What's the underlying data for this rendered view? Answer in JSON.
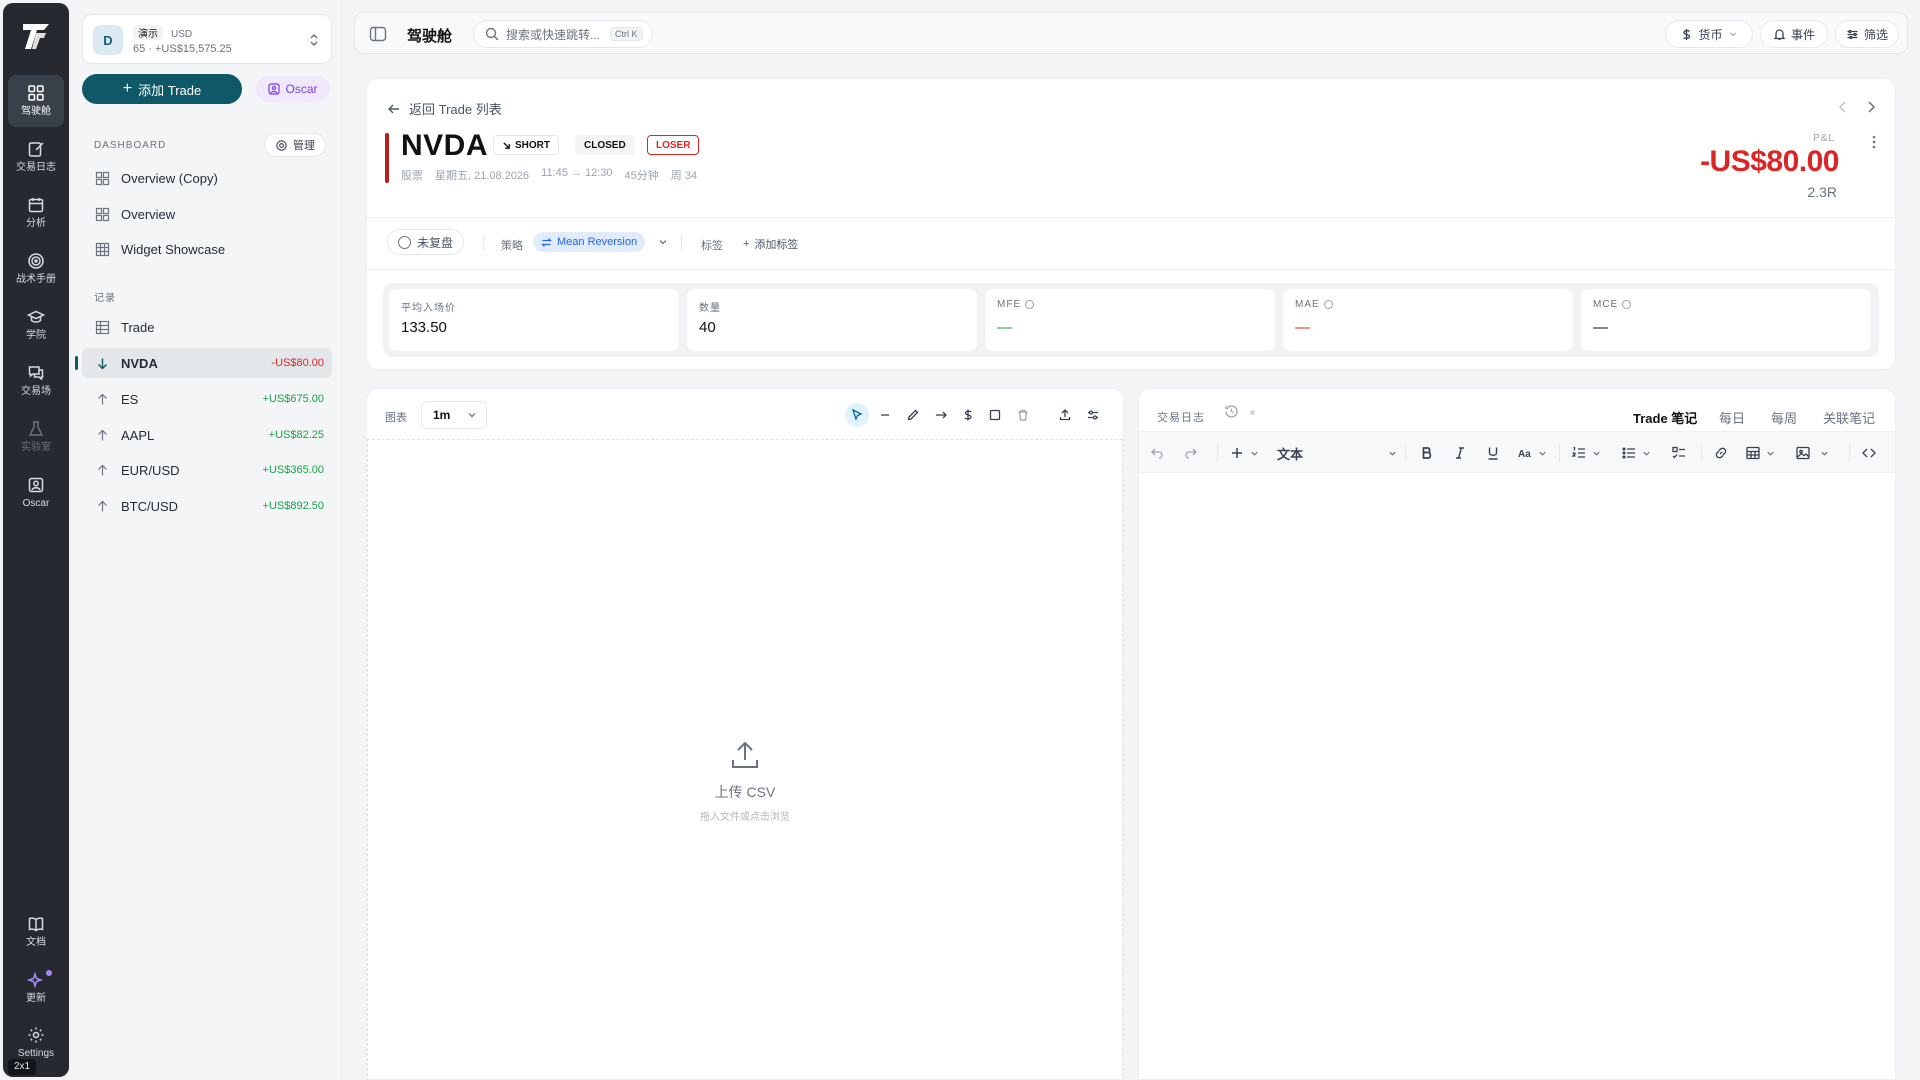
{
  "rail": {
    "items": [
      {
        "label": "驾驶舱",
        "icon": "dashboard-icon"
      },
      {
        "label": "交易日志",
        "icon": "journal-icon"
      },
      {
        "label": "分析",
        "icon": "calendar-icon"
      },
      {
        "label": "战术手册",
        "icon": "target-icon"
      },
      {
        "label": "学院",
        "icon": "graduation-icon"
      },
      {
        "label": "交易场",
        "icon": "chat-icon"
      },
      {
        "label": "实验室",
        "icon": "flask-icon"
      },
      {
        "label": "Oscar",
        "icon": "oscar-icon"
      }
    ],
    "bottom": [
      {
        "label": "文档",
        "icon": "book-icon"
      },
      {
        "label": "更新",
        "icon": "sparkle-icon"
      },
      {
        "label": "Settings",
        "icon": "gear-icon"
      }
    ],
    "badge": "2x1"
  },
  "account": {
    "avatar": "D",
    "name": "演示",
    "currency": "USD",
    "summary": "65 · +US$15,575.25"
  },
  "sidebar": {
    "add_trade": "添加 Trade",
    "oscar": "Oscar",
    "dashboard_label": "DASHBOARD",
    "manage": "管理",
    "dashboards": [
      {
        "label": "Overview (Copy)"
      },
      {
        "label": "Overview"
      },
      {
        "label": "Widget Showcase"
      }
    ],
    "records_label": "记录",
    "records_trade": "Trade",
    "trades": [
      {
        "symbol": "NVDA",
        "pnl": "-US$80.00",
        "dir": "down"
      },
      {
        "symbol": "ES",
        "pnl": "+US$675.00",
        "dir": "up"
      },
      {
        "symbol": "AAPL",
        "pnl": "+US$82.25",
        "dir": "up"
      },
      {
        "symbol": "EUR/USD",
        "pnl": "+US$365.00",
        "dir": "up"
      },
      {
        "symbol": "BTC/USD",
        "pnl": "+US$892.50",
        "dir": "up"
      }
    ]
  },
  "topbar": {
    "title": "驾驶舱",
    "search_placeholder": "搜索或快速跳转...",
    "shortcut": "Ctrl K",
    "currency": "货币",
    "events": "事件",
    "filter": "筛选"
  },
  "trade": {
    "back": "返回 Trade 列表",
    "symbol": "NVDA",
    "side": "SHORT",
    "status": "CLOSED",
    "result": "LOSER",
    "meta": [
      "股票",
      "星期五, 21.08.2026",
      "11:45 → 12:30",
      "45分钟",
      "周 34"
    ],
    "pnl_label": "P&L",
    "pnl": "-US$80.00",
    "r_multiple": "2.3R",
    "review": "未复盘",
    "strategy_label": "策略",
    "strategy": "Mean Reversion",
    "tags_label": "标签",
    "add_tag": "添加标签",
    "stats": [
      {
        "key": "平均入场价",
        "value": "133.50",
        "info": false,
        "tone": ""
      },
      {
        "key": "数量",
        "value": "40",
        "info": false,
        "tone": ""
      },
      {
        "key": "MFE",
        "value": "—",
        "info": true,
        "tone": "green"
      },
      {
        "key": "MAE",
        "value": "—",
        "info": true,
        "tone": "red"
      },
      {
        "key": "MCE",
        "value": "—",
        "info": true,
        "tone": ""
      }
    ]
  },
  "chart": {
    "label": "图表",
    "timeframe": "1m",
    "upload_title": "上传 CSV",
    "upload_hint": "拖入文件或点击浏览"
  },
  "journal": {
    "label": "交易日志",
    "tabs": [
      "Trade 笔记",
      "每日",
      "每周",
      "关联笔记"
    ],
    "block_type": "文本"
  },
  "colors": {
    "accent": "#0f5868",
    "loss": "#dc2626",
    "gain": "#16a34a",
    "rail": "#262a30"
  }
}
